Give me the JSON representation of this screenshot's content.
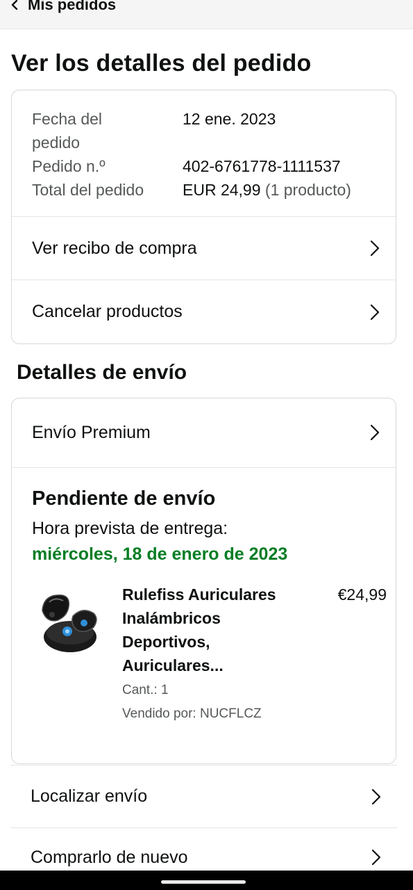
{
  "header": {
    "back_label": "Mis pedidos"
  },
  "page": {
    "title": "Ver los detalles del pedido"
  },
  "summary": {
    "rows": [
      {
        "label": "Fecha del\npedido",
        "value": "12 ene. 2023"
      },
      {
        "label": "Pedido n.º",
        "value": "402-6761778-1111537"
      },
      {
        "label": "Total del pedido",
        "value": "EUR 24,99",
        "extra": "(1 producto)"
      }
    ]
  },
  "actions": {
    "receipt": "Ver recibo de compra",
    "cancel": "Cancelar productos"
  },
  "shipping": {
    "section_title": "Detalles de envío",
    "method": "Envío Premium",
    "status": "Pendiente de envío",
    "eta_label": "Hora prevista de entrega:",
    "eta_date": "miércoles, 18 de enero de 2023"
  },
  "product": {
    "name": "Rulefiss Auriculares Inalámbricos Deportivos, Auriculares...",
    "price": "€24,99",
    "quantity": "Cant.: 1",
    "seller": "Vendido por: NUCFLCZ",
    "image_icon": "earbuds-image"
  },
  "more_actions": {
    "track": "Localizar envío",
    "buy_again": "Comprarlo de nuevo"
  },
  "colors": {
    "eta_green": "#067d24",
    "border": "#d5d9d9",
    "muted": "#565959"
  }
}
